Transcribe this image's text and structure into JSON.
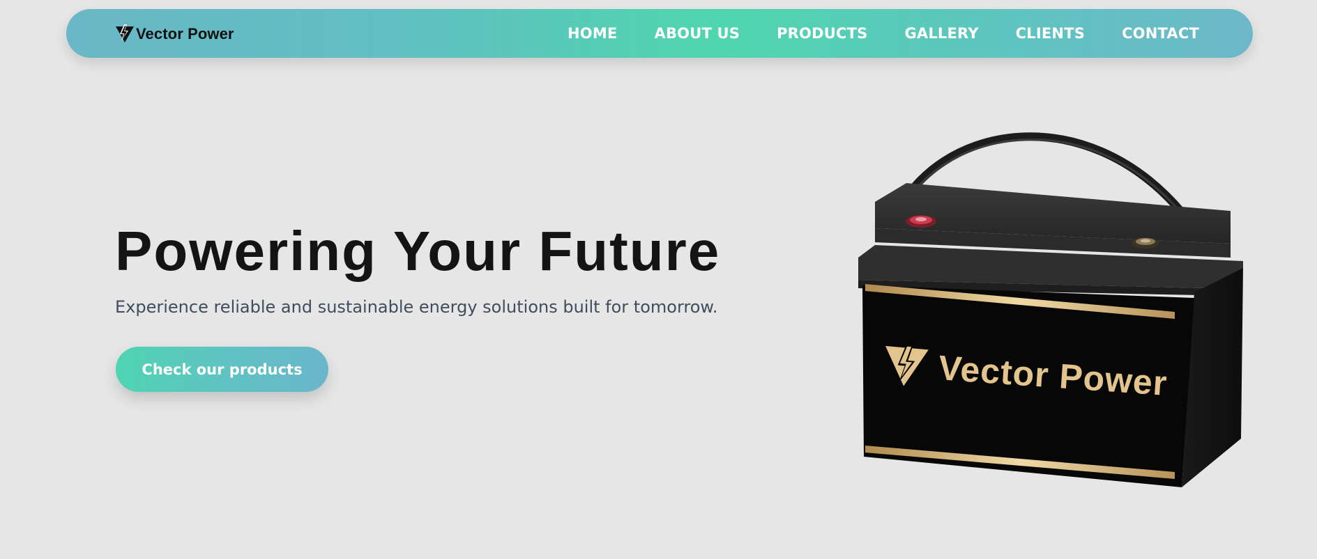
{
  "brand": {
    "name": "Vector Power",
    "icon": "bolt-triangle-logo-icon"
  },
  "nav": {
    "items": [
      {
        "label": "HOME"
      },
      {
        "label": "ABOUT US"
      },
      {
        "label": "PRODUCTS"
      },
      {
        "label": "GALLERY"
      },
      {
        "label": "CLIENTS"
      },
      {
        "label": "CONTACT"
      }
    ]
  },
  "hero": {
    "title": "Powering Your Future",
    "subtitle": "Experience reliable and sustainable energy solutions built for tomorrow.",
    "cta_label": "Check our products"
  },
  "product": {
    "label": "Vector Power",
    "icon": "battery-product-image"
  },
  "colors": {
    "background": "#e6e6e6",
    "nav_gradient_start": "#6ab7c7",
    "nav_gradient_mid": "#4fd6ae",
    "title_text": "#141414",
    "subtitle_text": "#3f4d5e",
    "battery_label": "#e3c48d"
  }
}
